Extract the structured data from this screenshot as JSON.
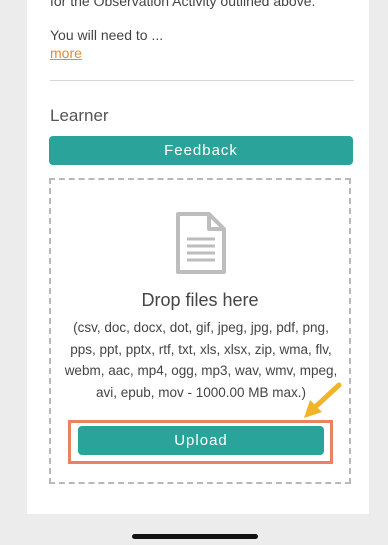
{
  "content": {
    "cut_text": "for the Observation Activity outlined above.",
    "need_text": "You will need to ...",
    "more_link": "more"
  },
  "section": {
    "label": "Learner"
  },
  "buttons": {
    "feedback": "Feedback",
    "upload": "Upload"
  },
  "dropzone": {
    "title": "Drop files here",
    "formats": "(csv, doc, docx, dot, gif, jpeg, jpg, pdf, png, pps, ppt, pptx, rtf, txt, xls, xlsx, zip, wma, flv, webm, aac, mp4, ogg, mp3, wav, wmv, mpeg, avi, epub, mov - 1000.00 MB max.)"
  },
  "colors": {
    "accent": "#2aa49a",
    "highlight": "#e9825f",
    "arrow": "#f0b429",
    "link": "#e08a3a"
  },
  "icons": {
    "file": "document-icon",
    "pointer": "arrow-icon"
  }
}
